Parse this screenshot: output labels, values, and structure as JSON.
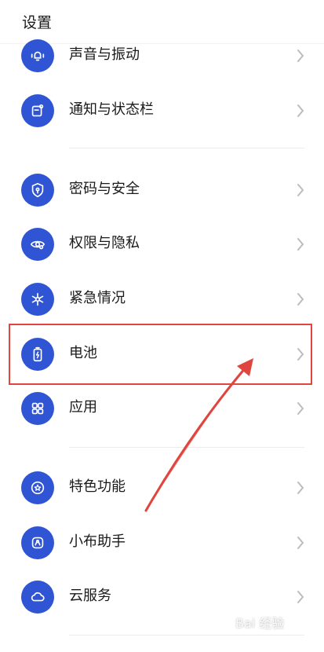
{
  "header": {
    "title": "设置"
  },
  "items": [
    {
      "label": "声音与振动",
      "icon": "bell-vibrate-icon"
    },
    {
      "label": "通知与状态栏",
      "icon": "notification-icon"
    },
    {
      "label": "密码与安全",
      "icon": "shield-lock-icon"
    },
    {
      "label": "权限与隐私",
      "icon": "eye-privacy-icon"
    },
    {
      "label": "紧急情况",
      "icon": "emergency-icon"
    },
    {
      "label": "电池",
      "icon": "battery-icon"
    },
    {
      "label": "应用",
      "icon": "apps-grid-icon"
    },
    {
      "label": "特色功能",
      "icon": "star-circle-icon"
    },
    {
      "label": "小布助手",
      "icon": "assistant-icon"
    },
    {
      "label": "云服务",
      "icon": "cloud-icon"
    }
  ],
  "colors": {
    "accent": "#2f55d4",
    "highlight": "#e0453e"
  },
  "watermark": {
    "text": "Bai 经验"
  }
}
